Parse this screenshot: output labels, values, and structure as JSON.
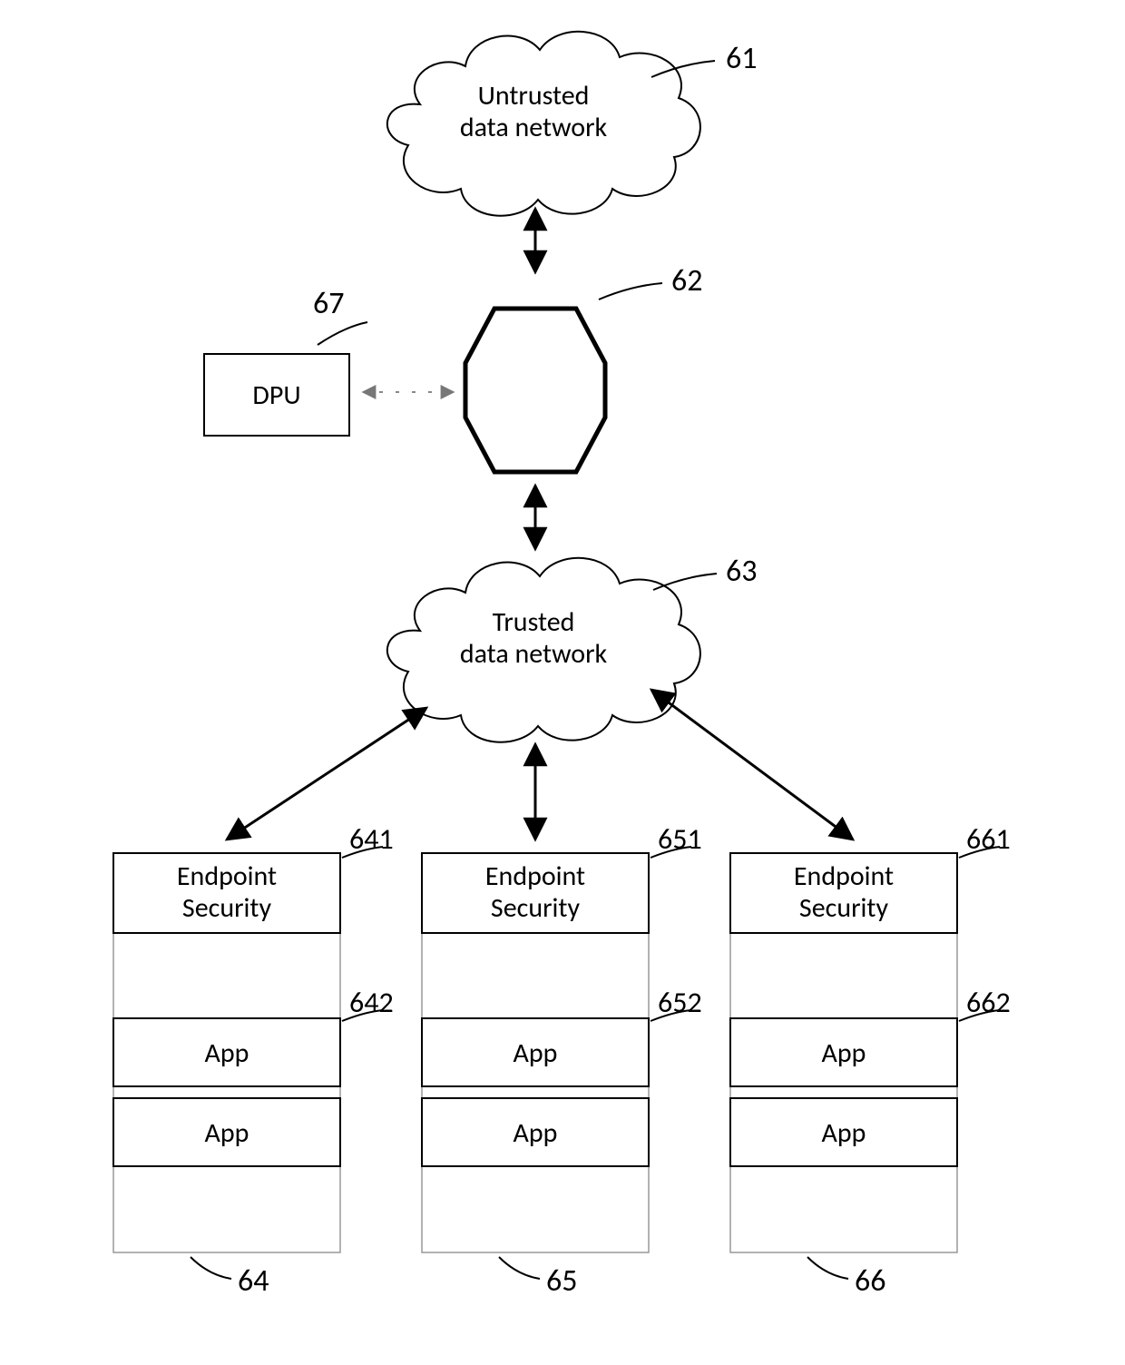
{
  "clouds": {
    "untrusted": {
      "line1": "Untrusted",
      "line2": "data network",
      "ref": "61"
    },
    "trusted": {
      "line1": "Trusted",
      "line2": "data network",
      "ref": "63"
    }
  },
  "dpu": {
    "label": "DPU",
    "ref": "67"
  },
  "hex": {
    "ref": "62"
  },
  "stacks": [
    {
      "ref": "64",
      "blocks": [
        {
          "label1": "Endpoint",
          "label2": "Security",
          "ref": "641"
        },
        {
          "label1": "App",
          "ref": "642"
        },
        {
          "label1": "App"
        }
      ]
    },
    {
      "ref": "65",
      "blocks": [
        {
          "label1": "Endpoint",
          "label2": "Security",
          "ref": "651"
        },
        {
          "label1": "App",
          "ref": "652"
        },
        {
          "label1": "App"
        }
      ]
    },
    {
      "ref": "66",
      "blocks": [
        {
          "label1": "Endpoint",
          "label2": "Security",
          "ref": "661"
        },
        {
          "label1": "App",
          "ref": "662"
        },
        {
          "label1": "App"
        }
      ]
    }
  ]
}
